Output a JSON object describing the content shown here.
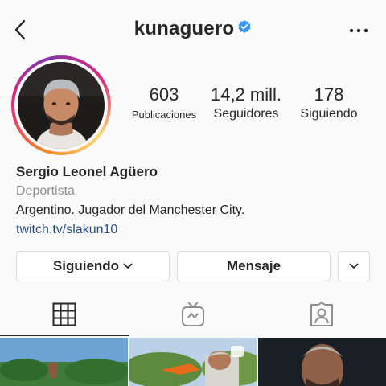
{
  "header": {
    "username": "kunaguero",
    "verified": true,
    "back_icon": "chevron-left-icon",
    "more_icon": "more-horizontal-icon"
  },
  "stats": {
    "posts": {
      "value": "603",
      "label": "Publicaciones"
    },
    "followers": {
      "value": "14,2 mill.",
      "label": "Seguidores"
    },
    "following": {
      "value": "178",
      "label": "Siguiendo"
    }
  },
  "bio": {
    "name": "Sergio Leonel Agüero",
    "category": "Deportista",
    "text": "Argentino. Jugador del Manchester City.",
    "link": "twitch.tv/slakun10"
  },
  "actions": {
    "following_label": "Siguiendo",
    "message_label": "Mensaje",
    "more_icon": "chevron-down-icon"
  },
  "tabs": [
    {
      "name": "grid",
      "icon": "grid-icon",
      "active": true
    },
    {
      "name": "igtv",
      "icon": "igtv-icon",
      "active": false
    },
    {
      "name": "tagged",
      "icon": "tagged-user-icon",
      "active": false
    }
  ],
  "posts_grid": [
    {
      "kind": "photo",
      "description": "outdoor green field"
    },
    {
      "kind": "photo",
      "description": "player with orange boots"
    },
    {
      "kind": "photo",
      "description": "portrait dark background"
    }
  ],
  "colors": {
    "verified": "#3897f0",
    "link": "#2b4c80",
    "secondary_text": "#8e8e8e",
    "border": "#dbdbdb"
  }
}
